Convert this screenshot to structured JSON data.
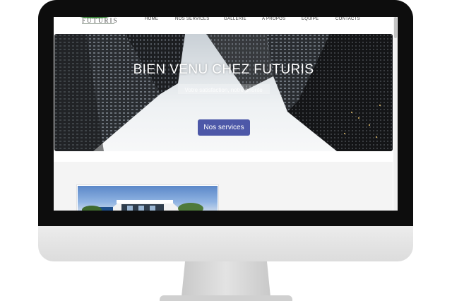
{
  "site": {
    "logo_text": "FUTURIS"
  },
  "nav": {
    "items": [
      {
        "id": "home",
        "label": "HOME"
      },
      {
        "id": "services",
        "label": "NOS SERVICES"
      },
      {
        "id": "gallery",
        "label": "GALLERIE"
      },
      {
        "id": "about",
        "label": "A PROPOS"
      },
      {
        "id": "team",
        "label": "EQUIPE"
      },
      {
        "id": "contacts",
        "label": "CONTACTS"
      }
    ]
  },
  "hero": {
    "title": "BIEN VENU CHEZ FUTURIS",
    "subtitle": "Votre satisfaction, notre priorite",
    "button_label": "Nos services"
  },
  "colors": {
    "accent": "#4d58a8",
    "logo_green": "#3d8b3d",
    "bezel": "#0d0d0d",
    "chin": "#e4e4e4"
  }
}
